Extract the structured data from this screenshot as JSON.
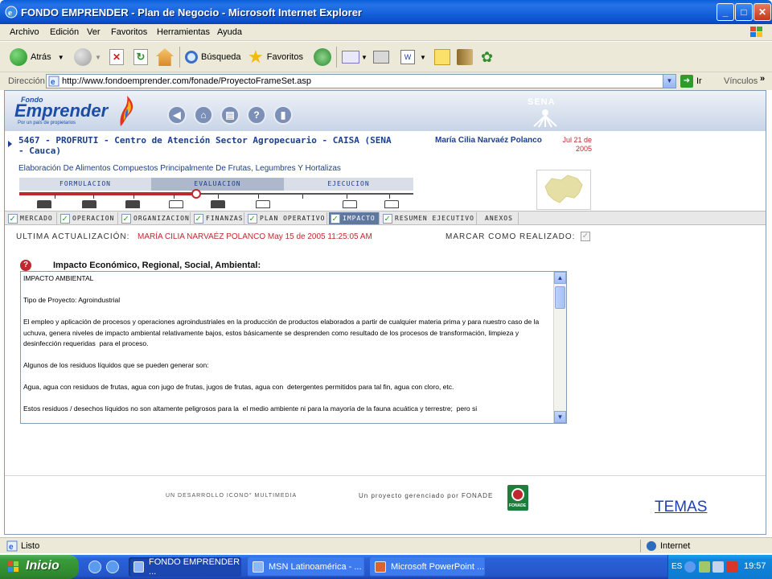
{
  "window": {
    "title": "FONDO EMPRENDER - Plan de Negocio - Microsoft Internet Explorer"
  },
  "menu": [
    "Archivo",
    "Edición",
    "Ver",
    "Favoritos",
    "Herramientas",
    "Ayuda"
  ],
  "toolbar": {
    "back": "Atrás",
    "search": "Búsqueda",
    "favorites": "Favoritos"
  },
  "address": {
    "label": "Dirección",
    "url": "http://www.fondoemprender.com/fonade/ProyectoFrameSet.asp",
    "go": "Ir",
    "links": "Vínculos",
    "more": "»"
  },
  "site": {
    "logo_top": "Fondo",
    "logo_main": "Emprender",
    "logo_tagline": "Por un país de propietarios",
    "sena": "SENA"
  },
  "project": {
    "title": "5467 - PROFRUTI - Centro de Atención Sector Agropecuario - CAISA (SENA - Cauca)",
    "user": "María Cilia Narvaéz Polanco",
    "date": "Jul 21 de 2005",
    "subtitle": "Elaboración De Alimentos Compuestos Principalmente De Frutas, Legumbres Y Hortalizas",
    "progress": 0.45
  },
  "phases": [
    "FORMULACION",
    "EVALUACION",
    "EJECUCION"
  ],
  "tabs": [
    {
      "label": "MERCADO",
      "checked": true
    },
    {
      "label": "OPERACION",
      "checked": true
    },
    {
      "label": "ORGANIZACION",
      "checked": true
    },
    {
      "label": "FINANZAS",
      "checked": true
    },
    {
      "label": "PLAN OPERATIVO",
      "checked": true
    },
    {
      "label": "IMPACTO",
      "checked": true,
      "active": true
    },
    {
      "label": "RESUMEN EJECUTIVO",
      "checked": true
    },
    {
      "label": "ANEXOS",
      "checked": false
    }
  ],
  "update": {
    "label": "ULTIMA ACTUALIZACIÓN:",
    "value": "MARÍA CILIA NARVAÉZ POLANCO  May 15 de 2005 11:25:05 AM",
    "mark_label": "MARCAR COMO REALIZADO:",
    "mark_checked": true
  },
  "section": {
    "help_glyph": "?",
    "title": "Impacto Económico, Regional, Social, Ambiental:",
    "text": "IMPACTO AMBIENTAL\n\nTipo de Proyecto: Agroindustrial\n\nEl empleo y aplicación de procesos y operaciones agroindustriales en la producción de productos elaborados a partir de cualquier materia prima y para nuestro caso de la uchuva, genera niveles de impacto ambiental relativamente bajos, estos básicamente se desprenden como resultado de los procesos de transformación, limpieza y desinfección requeridas  para el proceso.\n\nAlgunos de los residuos líquidos que se pueden generar son:\n\nAgua, agua con residuos de frutas, agua con jugo de frutas, jugos de frutas, agua con  detergentes permitidos para tal fin, agua con cloro, etc.\n\nEstos residuos / desechos líquidos no son altamente peligrosos para la  el medio ambiente ni para la mayoría de la fauna acuática y terrestre;  pero si"
  },
  "footer": {
    "developer": "UN DESARROLLO ICONO° MULTIMEDIA",
    "managed_by": "Un proyecto gerenciado por  FONADE",
    "fonade_label": "FONADE",
    "temas_link": "TEMAS"
  },
  "status": {
    "text": "Listo",
    "zone": "Internet"
  },
  "taskbar": {
    "start": "Inicio",
    "buttons": [
      {
        "label": "FONDO EMPRENDER ...",
        "active": true
      },
      {
        "label": "MSN Latinoamérica - ...",
        "active": false
      },
      {
        "label": "Microsoft PowerPoint ...",
        "active": false
      }
    ],
    "lang": "ES",
    "clock": "19:57"
  },
  "colors": {
    "accent_red": "#c0282d",
    "brand_blue": "#1b3f8a",
    "tab_active": "#5f78a0",
    "xp_blue": "#2456ca"
  }
}
